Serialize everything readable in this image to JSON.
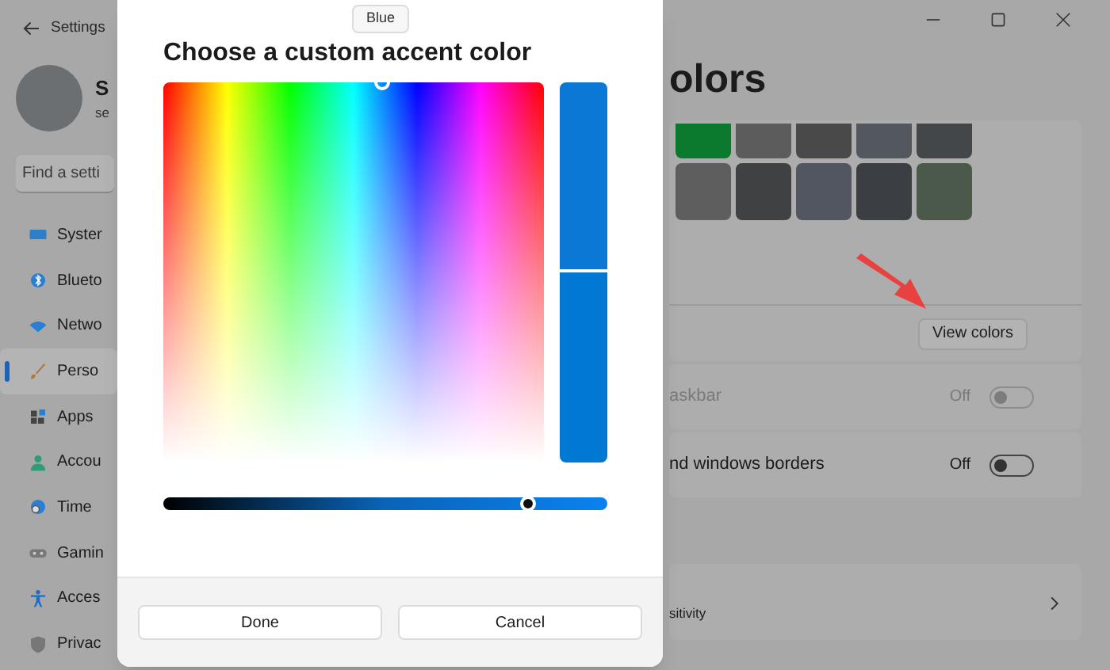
{
  "window": {
    "title": "Settings"
  },
  "account": {
    "name": "S",
    "email": "se"
  },
  "search": {
    "placeholder": "Find a setti"
  },
  "nav": [
    {
      "label": "Syster",
      "selected": false
    },
    {
      "label": "Blueto",
      "selected": false
    },
    {
      "label": "Netwo",
      "selected": false
    },
    {
      "label": "Perso",
      "selected": true
    },
    {
      "label": "Apps",
      "selected": false
    },
    {
      "label": "Accou",
      "selected": false
    },
    {
      "label": "Time",
      "selected": false
    },
    {
      "label": "Gamin",
      "selected": false
    },
    {
      "label": "Acces",
      "selected": false
    },
    {
      "label": "Privac",
      "selected": false
    }
  ],
  "page": {
    "title": "olors"
  },
  "swatch_rows": [
    [
      {
        "color": "#0b7a2e"
      },
      {
        "color": "#5c5c5c"
      },
      {
        "color": "#494949"
      },
      {
        "color": "#53585e"
      },
      {
        "color": "#43474a"
      }
    ],
    [
      {
        "color": "#5e5e5e"
      },
      {
        "color": "#3f4142"
      },
      {
        "color": "#515660"
      },
      {
        "color": "#3b3e43"
      },
      {
        "color": "#4b594b"
      }
    ]
  ],
  "view_colors_button": "View colors",
  "settings_rows": [
    {
      "label": "askbar",
      "state": "Off",
      "on": false,
      "disabled": true
    },
    {
      "label": "nd windows borders",
      "state": "Off",
      "on": false,
      "disabled": false
    }
  ],
  "link_row": {
    "label": "sitivity"
  },
  "dialog": {
    "title": "Choose a custom accent color",
    "tooltip": "Blue",
    "hue_slider": {
      "level": 0.82
    },
    "buttons": [
      "Done",
      "Cancel"
    ]
  }
}
